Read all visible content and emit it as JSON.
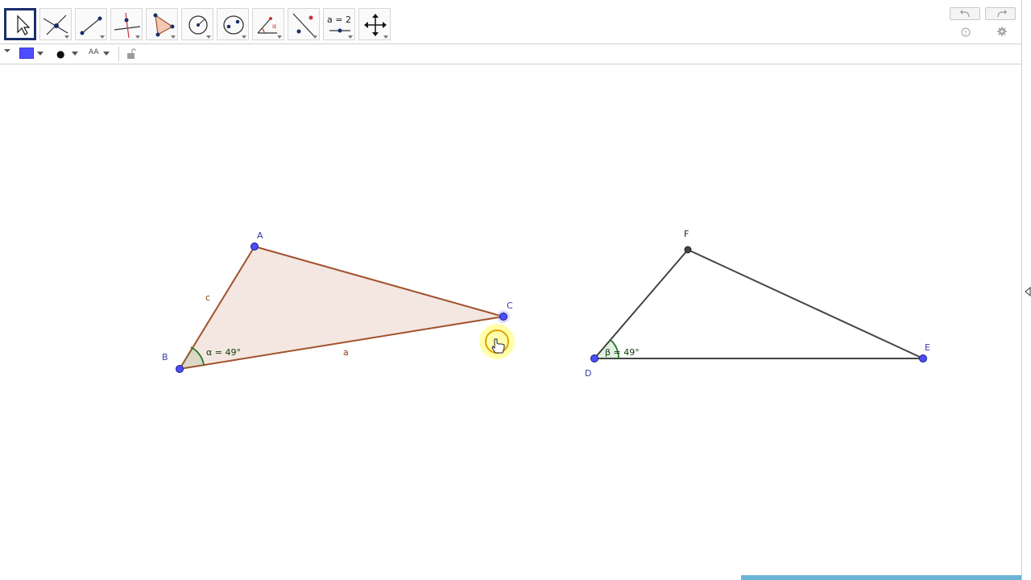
{
  "toolbar": {
    "tools": [
      {
        "id": "move",
        "name": "move-tool-button"
      },
      {
        "id": "point",
        "name": "point-tool-button"
      },
      {
        "id": "line",
        "name": "line-tool-button"
      },
      {
        "id": "perpendicular",
        "name": "perpendicular-line-tool-button"
      },
      {
        "id": "polygon",
        "name": "polygon-tool-button"
      },
      {
        "id": "circle",
        "name": "circle-tool-button"
      },
      {
        "id": "conic",
        "name": "conic-tool-button"
      },
      {
        "id": "angle",
        "name": "angle-tool-button"
      },
      {
        "id": "reflect",
        "name": "reflect-tool-button"
      },
      {
        "id": "slider",
        "name": "slider-tool-button",
        "label": "a = 2"
      },
      {
        "id": "move-view",
        "name": "move-graphics-view-tool-button"
      }
    ],
    "selected_tool": "move"
  },
  "icons": [
    "undo-icon",
    "redo-icon",
    "help-icon",
    "gear-icon",
    "chevron-down-icon",
    "lock-icon",
    "panel-toggle-icon"
  ],
  "colors": {
    "accent": "#1c2d6b",
    "point_free": "#4d4dff",
    "point_dependent": "#444444",
    "triangle_stroke": "#a0522d",
    "triangle_fill": "#f2e2db",
    "angle": "#1e7a1e",
    "segment_dark": "#444444",
    "highlight": "#ffff66"
  },
  "stylebar": {
    "color_swatch": "#4d4dff",
    "point_style": "●",
    "text_style": "AA"
  },
  "construction": {
    "triangle1": {
      "points": [
        {
          "label": "A"
        },
        {
          "label": "B"
        },
        {
          "label": "C"
        }
      ],
      "side_labels": {
        "c": "c",
        "a": "a"
      },
      "angle_label": "α = 49°"
    },
    "triangle2": {
      "points": [
        {
          "label": "D"
        },
        {
          "label": "E"
        },
        {
          "label": "F"
        }
      ],
      "angle_label": "β = 49°"
    }
  }
}
